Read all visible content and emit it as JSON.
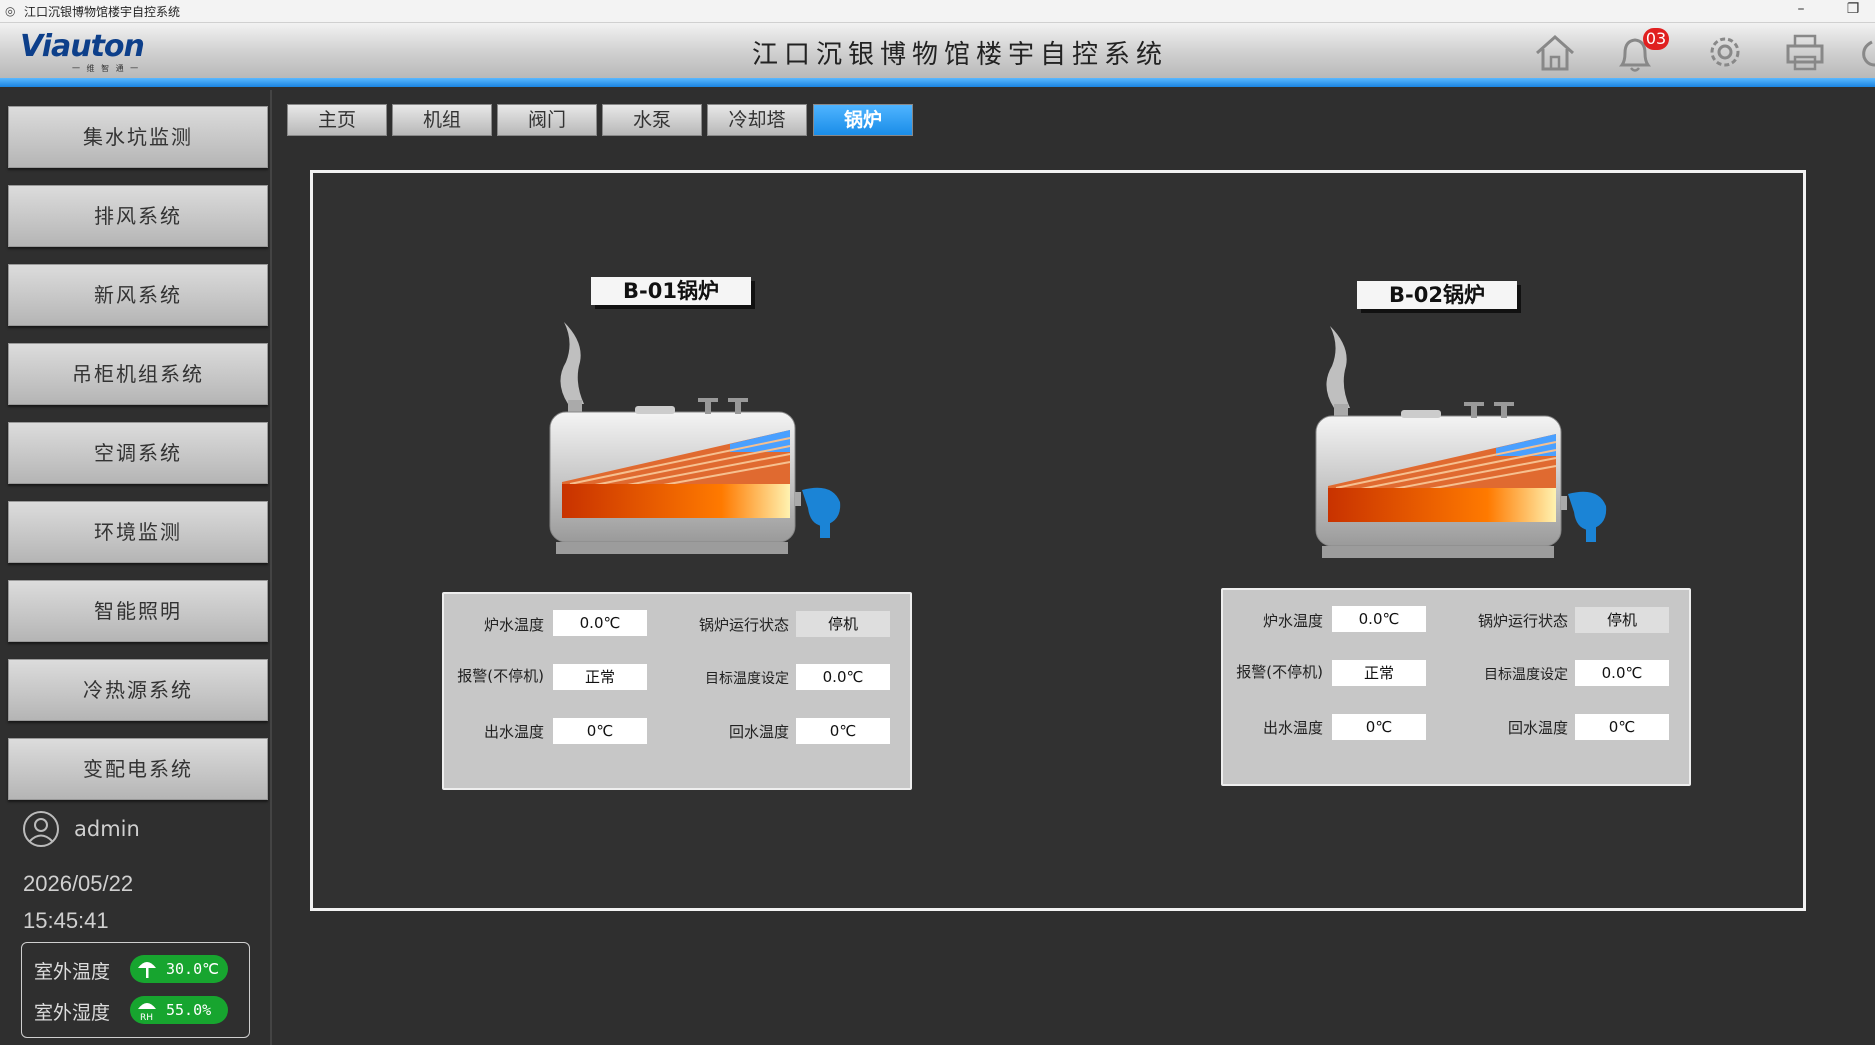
{
  "window": {
    "title": "江口沉银博物馆楼宇自控系统",
    "minimize": "–",
    "restore": "❐"
  },
  "header": {
    "logo_text": "Viauton",
    "logo_sub": "一 维 智 通 一",
    "title": "江口沉银博物馆楼宇自控系统",
    "alarm_count": "03",
    "icons": [
      "home-icon",
      "bell-icon",
      "gear-icon",
      "printer-icon"
    ]
  },
  "sidebar": {
    "items": [
      {
        "label": "集水坑监测"
      },
      {
        "label": "排风系统"
      },
      {
        "label": "新风系统"
      },
      {
        "label": "吊柜机组系统"
      },
      {
        "label": "空调系统"
      },
      {
        "label": "环境监测"
      },
      {
        "label": "智能照明"
      },
      {
        "label": "冷热源系统"
      },
      {
        "label": "变配电系统"
      }
    ],
    "user": "admin",
    "date": "2026/05/22",
    "time": "15:45:41",
    "outdoor_temp_label": "室外温度",
    "outdoor_temp_value": "30.0℃",
    "outdoor_hum_label": "室外湿度",
    "outdoor_hum_value": "55.0%"
  },
  "tabs": [
    {
      "label": "主页"
    },
    {
      "label": "机组"
    },
    {
      "label": "阀门"
    },
    {
      "label": "水泵"
    },
    {
      "label": "冷却塔"
    },
    {
      "label": "锅炉",
      "active": true
    }
  ],
  "boilers": [
    {
      "name": "B-01锅炉",
      "furnace_water_temp_label": "炉水温度",
      "furnace_water_temp": "0.0℃",
      "run_status_label": "锅炉运行状态",
      "run_status": "停机",
      "alarm_label": "报警(不停机)",
      "alarm": "正常",
      "target_temp_label": "目标温度设定",
      "target_temp": "0.0℃",
      "outlet_temp_label": "出水温度",
      "outlet_temp": "0℃",
      "return_temp_label": "回水温度",
      "return_temp": "0℃"
    },
    {
      "name": "B-02锅炉",
      "furnace_water_temp_label": "炉水温度",
      "furnace_water_temp": "0.0℃",
      "run_status_label": "锅炉运行状态",
      "run_status": "停机",
      "alarm_label": "报警(不停机)",
      "alarm": "正常",
      "target_temp_label": "目标温度设定",
      "target_temp": "0.0℃",
      "outlet_temp_label": "出水温度",
      "outlet_temp": "0℃",
      "return_temp_label": "回水温度",
      "return_temp": "0℃"
    }
  ],
  "colors": {
    "accent": "#1a8de8",
    "background": "#2f2f2f",
    "badge": "#e02020",
    "env_pill": "#17a52f"
  }
}
